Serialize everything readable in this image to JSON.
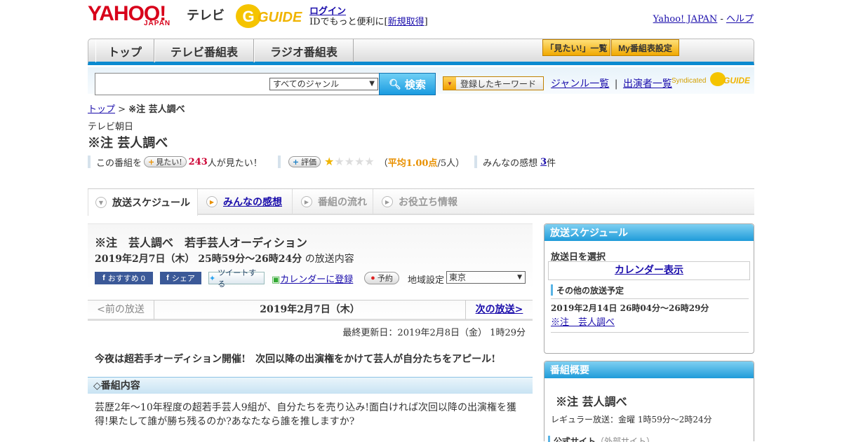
{
  "header": {
    "yahoo_logo": "YAHOO!",
    "yahoo_japan": "JAPAN",
    "tv_label": "テレビ",
    "gguide_logo": "GUIDE",
    "login_link": "ログイン",
    "login_sub_prefix": "IDでもっと便利に[",
    "signup_link": "新規取得",
    "login_sub_suffix": "]",
    "yahoo_japan_link": "Yahoo! JAPAN",
    "separator": "-",
    "help_link": "ヘルプ"
  },
  "nav": {
    "tabs": [
      "トップ",
      "テレビ番組表",
      "ラジオ番組表"
    ],
    "want_list_btn": "「見たい!」一覧",
    "my_schedule_btn": "My番組表設定"
  },
  "search": {
    "placeholder": "",
    "genre_selected": "すべてのジャンル",
    "search_btn": "検索",
    "keyword_btn": "登録したキーワード",
    "genre_list_link": "ジャンル一覧",
    "divider": "|",
    "performer_list_link": "出演者一覧",
    "syndicated": "Syndicated"
  },
  "breadcrumb": {
    "home": "トップ",
    "sep": ">",
    "current": "※注 芸人調べ"
  },
  "program": {
    "station": "テレビ朝日",
    "title": "※注 芸人調べ",
    "want_prefix": "この番組を",
    "want_btn": "見たい!",
    "want_count": "243",
    "want_suffix": "人が見たい！",
    "rating_btn": "評価",
    "rating_stars_on": 1,
    "rating_stars_total": 5,
    "rating_open": "（",
    "rating_avg": "平均1.00点",
    "rating_people": "/5人",
    "rating_close": "）",
    "impressions_label": "みんなの感想",
    "impressions_count": "3",
    "impressions_suffix": "件"
  },
  "subnav": {
    "tabs": [
      "放送スケジュール",
      "みんなの感想",
      "番組の流れ",
      "お役立ち情報"
    ]
  },
  "episode": {
    "title": "※注　芸人調べ　若手芸人オーディション",
    "date": "2019年2月7日（木） 25時59分～26時24分",
    "date_suffix": "の放送内容",
    "fb_recommend": "おすすめ 0",
    "fb_share": "シェア",
    "tweet": "ツイートする",
    "calendar": "カレンダーに登録",
    "reserve": "予約",
    "region_label": "地域設定",
    "region_value": "東京",
    "prev": "<前の放送",
    "current_date": "2019年2月7日（木）",
    "next": "次の放送>",
    "updated": "最終更新日：2019年2月8日（金） 1時29分",
    "lead": "今夜は超若手オーディション開催!　次回以降の出演権をかけて芸人が自分たちをアピール!",
    "section_title": "◇番組内容",
    "description": "芸歴2年～10年程度の超若手芸人9組が、自分たちを売り込み!面白ければ次回以降の出演権を獲得!果たして誰が勝ち残るのか?あなたなら誰を推しますか?"
  },
  "sidebar": {
    "schedule_title": "放送スケジュール",
    "select_date": "放送日を選択",
    "calendar_link": "カレンダー表示",
    "other_title": "その他の放送予定",
    "other_date": "2019年2月14日 26時04分～26時29分",
    "other_link": "※注　芸人調べ",
    "overview_title": "番組概要",
    "overview_name": "※注 芸人調べ",
    "overview_regular": "レギュラー放送：金曜 1時59分～2時24分",
    "official_site": "公式サイト",
    "external": "（外部サイト）"
  },
  "colors": {
    "accent_blue": "#0a8ad0",
    "yahoo_red": "#d8001a",
    "star": "#f0b400",
    "count_red": "#cc0033"
  }
}
